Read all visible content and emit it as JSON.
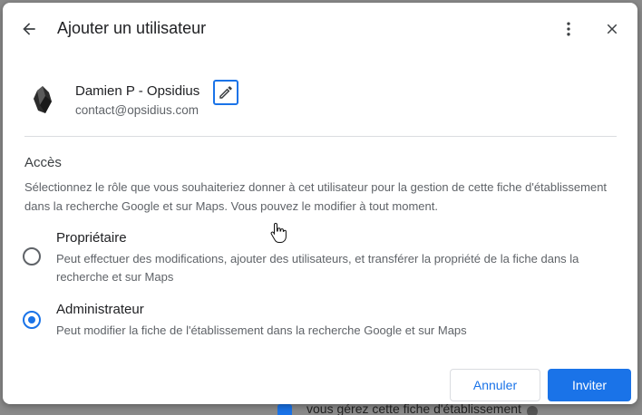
{
  "backdrop": {
    "text": "vous gérez cette fiche d'établissement"
  },
  "dialog": {
    "title": "Ajouter un utilisateur",
    "icons": {
      "back": "arrow-back-icon",
      "more": "more-vert-icon",
      "close": "close-icon",
      "edit": "pencil-icon"
    }
  },
  "user": {
    "name": "Damien P - Opsidius",
    "email": "contact@opsidius.com"
  },
  "access": {
    "title": "Accès",
    "description": "Sélectionnez le rôle que vous souhaiteriez donner à cet utilisateur pour la gestion de cette fiche d'établissement dans la recherche Google et sur Maps. Vous pouvez le modifier à tout moment.",
    "options": [
      {
        "label": "Propriétaire",
        "description": "Peut effectuer des modifications, ajouter des utilisateurs, et transférer la propriété de la fiche dans la recherche et sur Maps",
        "selected": false
      },
      {
        "label": "Administrateur",
        "description": "Peut modifier la fiche de l'établissement dans la recherche Google et sur Maps",
        "selected": true
      }
    ]
  },
  "actions": {
    "cancel": "Annuler",
    "invite": "Inviter"
  },
  "colors": {
    "accent": "#1a73e8",
    "text_primary": "#202124",
    "text_secondary": "#5f6368"
  }
}
